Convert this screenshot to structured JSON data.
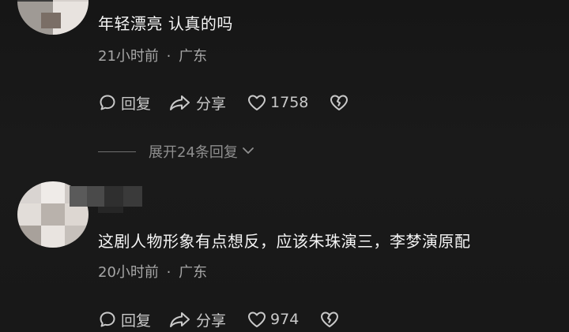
{
  "comments": [
    {
      "text": "年轻漂亮  认真的吗",
      "time": "21小时前",
      "separator": "·",
      "location": "广东",
      "reply_label": "回复",
      "share_label": "分享",
      "likes": "1758",
      "replies_label": "展开24条回复"
    },
    {
      "text": "这剧人物形象有点想反，应该朱珠演三，李梦演原配",
      "time": "20小时前",
      "separator": "·",
      "location": "广东",
      "reply_label": "回复",
      "share_label": "分享",
      "likes": "974"
    }
  ],
  "icons": {
    "reply": "speech-bubble-icon",
    "share": "share-arrow-icon",
    "like": "heart-outline-icon",
    "dislike": "broken-heart-icon",
    "expand": "chevron-down-icon"
  },
  "colors": {
    "background": "#181818",
    "text": "#f5f5f5",
    "meta": "#a6a6a6",
    "actions": "#c9c9c9",
    "replies": "#8f8f8f"
  }
}
